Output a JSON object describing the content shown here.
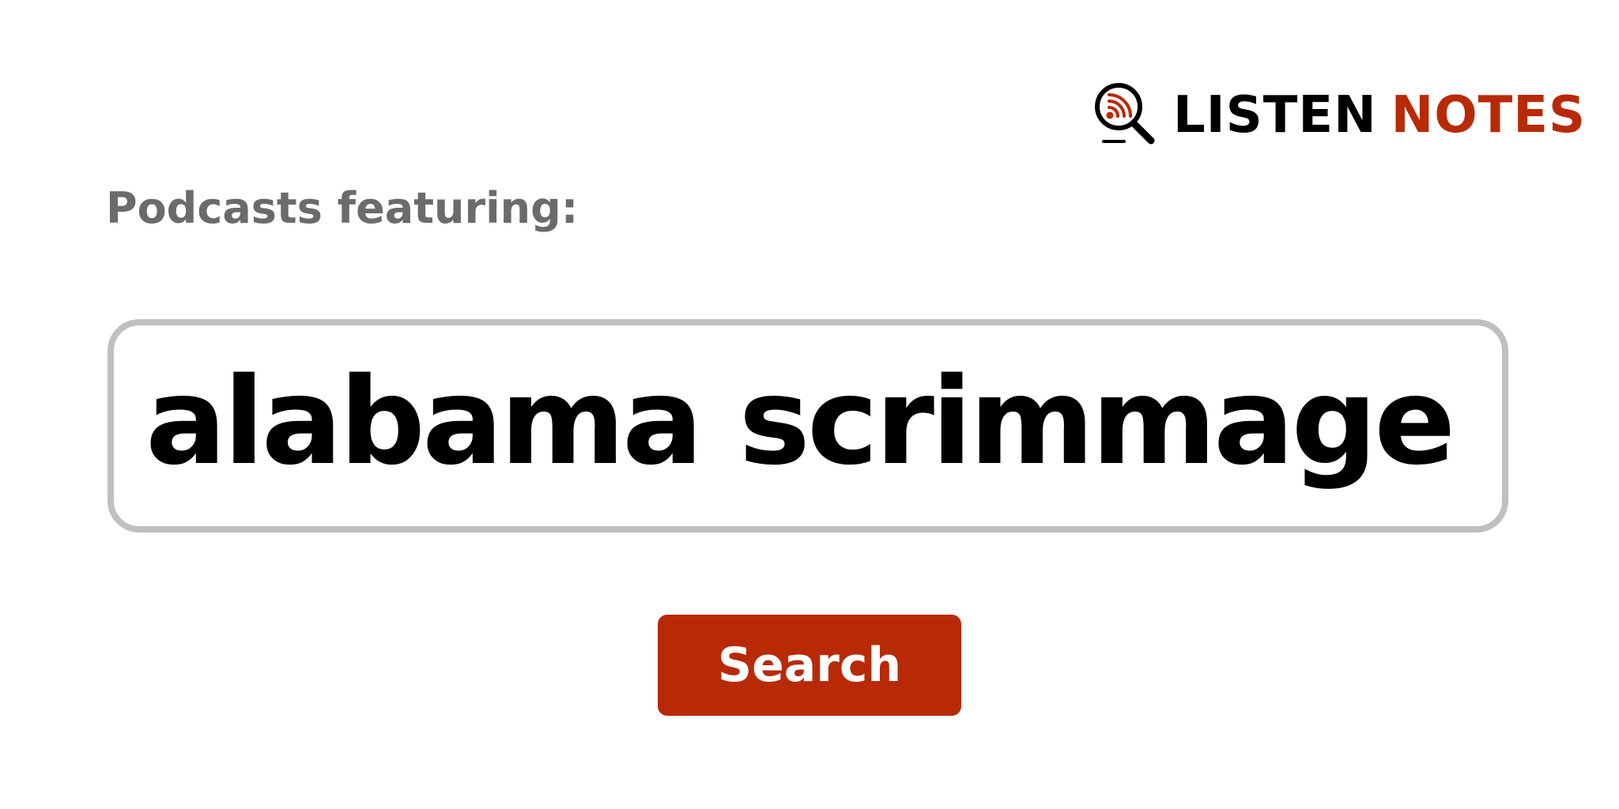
{
  "brand": {
    "name_part1": "LISTEN",
    "name_part2": "NOTES",
    "logo_icon": "magnifier-podcast-icon",
    "colors": {
      "black": "#000000",
      "accent": "#b82a06"
    }
  },
  "heading": {
    "label": "Podcasts featuring:"
  },
  "search": {
    "query": "alabama scrimmage",
    "button_label": "Search",
    "border_color": "#c0c0c0"
  }
}
